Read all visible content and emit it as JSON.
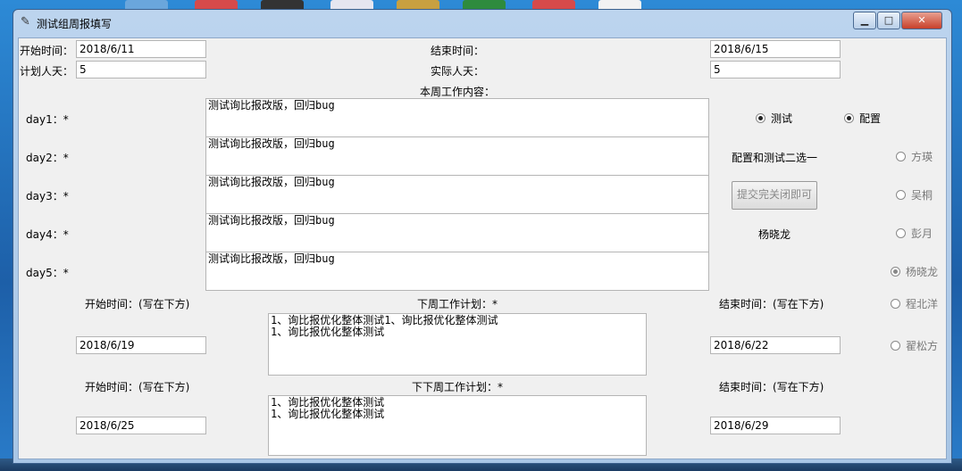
{
  "window": {
    "title": "测试组周报填写",
    "minimize_glyph": "▁",
    "maximize_glyph": "□",
    "close_glyph": "✕"
  },
  "header": {
    "start_label": "开始时间：",
    "start_value": "2018/6/11",
    "end_label": "结束时间：",
    "end_value": "2018/6/15",
    "plan_days_label": "计划人天：",
    "plan_days_value": "5",
    "actual_days_label": "实际人天：",
    "actual_days_value": "5"
  },
  "this_week": {
    "section_label": "本周工作内容：",
    "days": [
      {
        "label": "day1：*",
        "content": "测试询比报改版，回归bug"
      },
      {
        "label": "day2：*",
        "content": "测试询比报改版，回归bug"
      },
      {
        "label": "day3：*",
        "content": "测试询比报改版，回归bug"
      },
      {
        "label": "day4：*",
        "content": "测试询比报改版，回归bug"
      },
      {
        "label": "day5：*",
        "content": "测试询比报改版，回归bug"
      }
    ]
  },
  "type_choice": {
    "options": [
      {
        "label": "测试",
        "selected": true
      },
      {
        "label": "配置",
        "selected": true
      }
    ],
    "hint": "配置和测试二选一",
    "submit_label": "提交完关闭即可",
    "current_user": "杨晓龙"
  },
  "members": [
    {
      "name": "方瑛",
      "selected": false
    },
    {
      "name": "吴桐",
      "selected": false
    },
    {
      "name": "彭月",
      "selected": false
    },
    {
      "name": "杨晓龙",
      "selected": true
    },
    {
      "name": "程北洋",
      "selected": false
    },
    {
      "name": "翟松方",
      "selected": false
    }
  ],
  "next_week": {
    "start_label": "开始时间：(写在下方)",
    "start_value": "2018/6/19",
    "plan_label": "下周工作计划：*",
    "plan_content": "1、询比报优化整体测试1、询比报优化整体测试\n1、询比报优化整体测试",
    "end_label": "结束时间：(写在下方)",
    "end_value": "2018/6/22"
  },
  "week_after": {
    "start_label": "开始时间：(写在下方)",
    "start_value": "2018/6/25",
    "plan_label": "下下周工作计划：*",
    "plan_content": "1、询比报优化整体测试\n1、询比报优化整体测试",
    "end_label": "结束时间：(写在下方)",
    "end_value": "2018/6/29"
  },
  "colors": {
    "window_frame": "#a8c6e6",
    "client_bg": "#f0f0f0",
    "close_button": "#c8402a"
  }
}
